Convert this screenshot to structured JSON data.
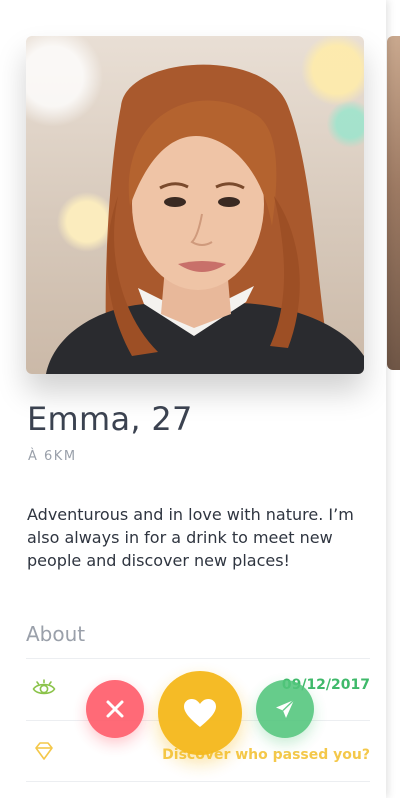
{
  "profile": {
    "name_age": "Emma, 27",
    "distance": "À 6KM",
    "bio": "Adventurous and in love with nature. I’m also always in for a drink to meet new people and discover new places!",
    "photo_alt": "Emma"
  },
  "about": {
    "heading": "About",
    "rows": [
      {
        "icon": "eye-icon",
        "value": "09/12/2017"
      },
      {
        "icon": "diamond-icon",
        "link": "Discover who passed you?"
      }
    ]
  },
  "actions": {
    "pass_icon": "close-icon",
    "like_icon": "heart-icon",
    "message_icon": "send-icon"
  },
  "colors": {
    "accent_gold": "#f5b91e",
    "pass_red": "#ff5f6d",
    "message_green": "#52c67c",
    "text_dark": "#3b4250",
    "text_muted": "#9aa0aa"
  }
}
